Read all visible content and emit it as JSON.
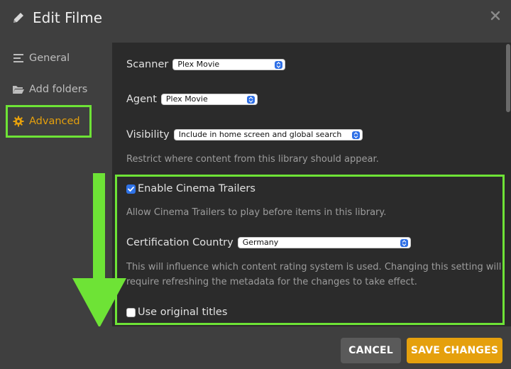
{
  "header": {
    "title": "Edit Filme",
    "icon": "pencil-icon",
    "close_icon": "close-icon"
  },
  "sidebar": {
    "items": [
      {
        "label": "General",
        "icon": "list-icon"
      },
      {
        "label": "Add folders",
        "icon": "folder-icon"
      },
      {
        "label": "Advanced",
        "icon": "gear-icon",
        "active": true
      }
    ]
  },
  "main": {
    "scanner": {
      "label": "Scanner",
      "value": "Plex Movie"
    },
    "agent": {
      "label": "Agent",
      "value": "Plex Movie"
    },
    "visibility": {
      "label": "Visibility",
      "value": "Include in home screen and global search",
      "help": "Restrict where content from this library should appear."
    },
    "cinema_trailers": {
      "label": "Enable Cinema Trailers",
      "checked": true,
      "help": "Allow Cinema Trailers to play before items in this library."
    },
    "certification_country": {
      "label": "Certification Country",
      "value": "Germany",
      "help_line1": "This will influence which content rating system is used. Changing this setting will",
      "help_line2": "require refreshing the metadata for the changes to take effect."
    },
    "original_titles": {
      "label": "Use original titles",
      "checked": false
    }
  },
  "footer": {
    "cancel_label": "CANCEL",
    "save_label": "SAVE CHANGES"
  },
  "colors": {
    "accent": "#e5a00d",
    "highlight": "#6ee336",
    "checkbox": "#2f73e8",
    "select_arrow": "#2e6fe6"
  }
}
